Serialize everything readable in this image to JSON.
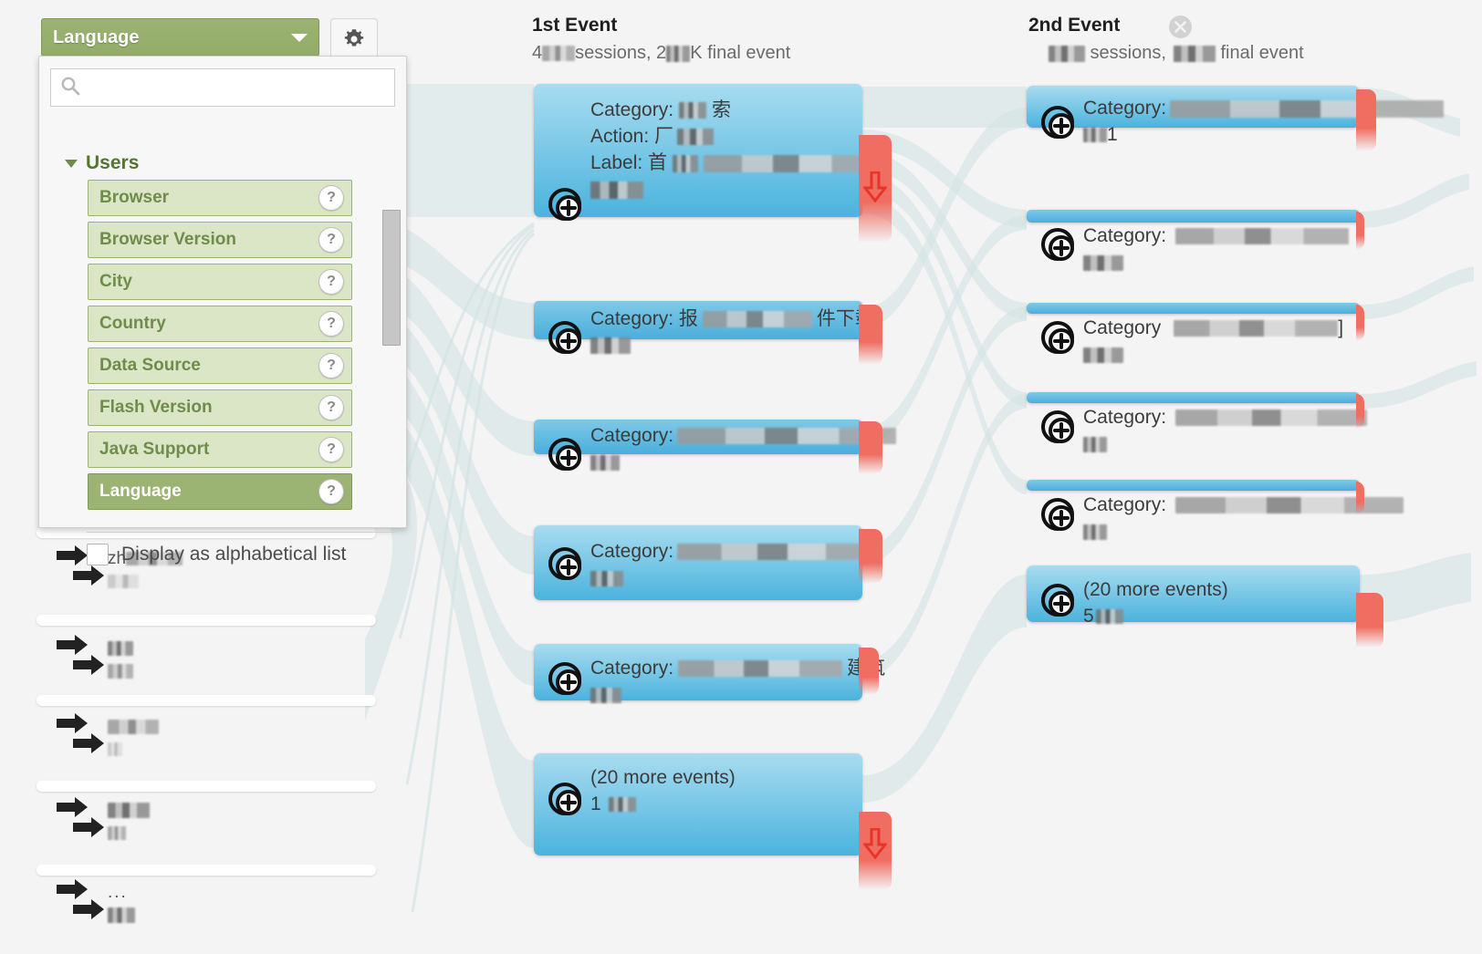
{
  "app": {
    "background": "#f4f4f4",
    "accent_green": "#9bb373",
    "node_blue": "#4bb3dd",
    "dropoff_red": "#ef6d61"
  },
  "dimension_selector": {
    "selected_label": "Language",
    "caret_icon": "chevron-down-icon",
    "gear_icon": "gear-icon",
    "search": {
      "placeholder": "",
      "value": "",
      "icon": "search-icon"
    },
    "group": {
      "label": "Users",
      "expand_icon": "triangle-down-icon"
    },
    "items": [
      {
        "label": "Browser",
        "help": "?",
        "selected": false
      },
      {
        "label": "Browser Version",
        "help": "?",
        "selected": false
      },
      {
        "label": "City",
        "help": "?",
        "selected": false
      },
      {
        "label": "Country",
        "help": "?",
        "selected": false
      },
      {
        "label": "Data Source",
        "help": "?",
        "selected": false
      },
      {
        "label": "Flash Version",
        "help": "?",
        "selected": false
      },
      {
        "label": "Java Support",
        "help": "?",
        "selected": false
      },
      {
        "label": "Language",
        "help": "?",
        "selected": true
      }
    ],
    "alphabetical": {
      "label": "Display as alphabetical list",
      "checked": false
    }
  },
  "dimension_rows": [
    {
      "label": "zh",
      "label_redacted": true,
      "arrows_icon": "double-arrow-icon"
    },
    {
      "label": "",
      "label_redacted": true,
      "arrows_icon": "double-arrow-icon"
    },
    {
      "label": "",
      "label_redacted": true,
      "arrows_icon": "double-arrow-icon"
    },
    {
      "label": "",
      "label_redacted": true,
      "arrows_icon": "double-arrow-icon"
    },
    {
      "label": "...",
      "label_redacted": true,
      "arrows_icon": "double-arrow-icon"
    }
  ],
  "steps": [
    {
      "title": "1st Event",
      "subtitle": "4  sessions,    K final event",
      "subtitle_redacted": true,
      "closable": false
    },
    {
      "title": "2nd Event",
      "subtitle": "  sessions,    final event",
      "subtitle_redacted": true,
      "closable": true,
      "close_icon": "close-circle-icon"
    }
  ],
  "step1_nodes": [
    {
      "icon": "event-node-icon",
      "lines": [
        "Category:  索",
        "Action: 厂",
        "Label: 首",
        ""
      ],
      "redacted": true,
      "more_events": false
    },
    {
      "icon": "event-node-icon",
      "lines": [
        "Category: 报        件下载",
        ""
      ],
      "redacted": true,
      "more_events": false
    },
    {
      "icon": "event-node-icon",
      "lines": [
        "Category:",
        ""
      ],
      "redacted": true,
      "more_events": false
    },
    {
      "icon": "event-node-icon",
      "lines": [
        "Category:",
        ""
      ],
      "redacted": true,
      "more_events": false
    },
    {
      "icon": "event-node-icon",
      "lines": [
        "Category:              建筑",
        ""
      ],
      "redacted": true,
      "more_events": false
    },
    {
      "icon": "event-node-icon",
      "lines": [
        "(20 more events)",
        "1"
      ],
      "redacted": true,
      "more_events": true
    }
  ],
  "step2_nodes": [
    {
      "icon": "event-node-icon",
      "lines": [
        "Category:",
        ""
      ],
      "redacted": true,
      "more_events": false
    },
    {
      "icon": "event-node-icon",
      "lines": [
        "Category:",
        ""
      ],
      "redacted": true,
      "more_events": false
    },
    {
      "icon": "event-node-icon",
      "lines": [
        "Category",
        ""
      ],
      "redacted": true,
      "more_events": false
    },
    {
      "icon": "event-node-icon",
      "lines": [
        "Category:",
        ""
      ],
      "redacted": true,
      "more_events": false
    },
    {
      "icon": "event-node-icon",
      "lines": [
        "Category:",
        ""
      ],
      "redacted": true,
      "more_events": false
    },
    {
      "icon": "event-node-icon",
      "lines": [
        "(20 more events)",
        "5"
      ],
      "redacted": true,
      "more_events": true
    }
  ]
}
